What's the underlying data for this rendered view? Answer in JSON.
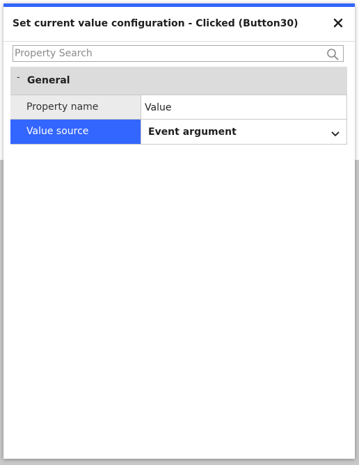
{
  "dialog": {
    "title": "Set current value configuration - Clicked (Button30)",
    "close_icon": "close-icon",
    "accent_color": "#3366ff"
  },
  "search": {
    "placeholder": "Property Search",
    "value": "",
    "icon": "search-icon"
  },
  "group": {
    "toggle": "-",
    "label": "General"
  },
  "properties": [
    {
      "name": "Property name",
      "value": "Value",
      "selected": false,
      "editor": "text"
    },
    {
      "name": "Value source",
      "value": "Event argument",
      "selected": true,
      "editor": "dropdown"
    }
  ],
  "colors": {
    "selected_row": "#3366ff",
    "group_header": "#dcdcdc",
    "name_cell": "#ebebeb"
  }
}
